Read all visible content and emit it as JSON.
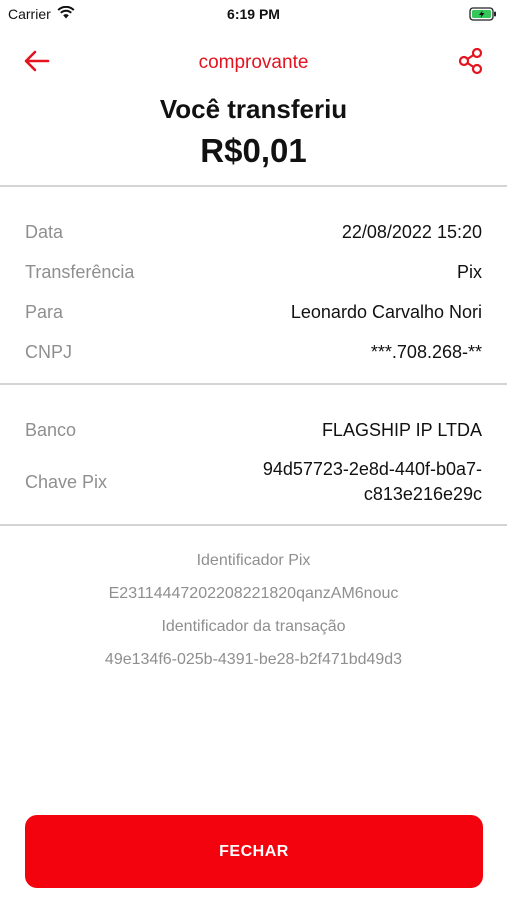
{
  "status_bar": {
    "carrier": "Carrier",
    "time": "6:19 PM"
  },
  "header": {
    "title": "comprovante",
    "accent_color": "#e3131f"
  },
  "hero": {
    "label": "Você transferiu",
    "amount": "R$0,01"
  },
  "details": [
    {
      "label": "Data",
      "value": "22/08/2022 15:20"
    },
    {
      "label": "Transferência",
      "value": "Pix"
    },
    {
      "label": "Para",
      "value": "Leonardo Carvalho Nori"
    },
    {
      "label": "CNPJ",
      "value": "***.708.268-**"
    }
  ],
  "bank": {
    "bank_label": "Banco",
    "bank_value": "FLAGSHIP IP LTDA",
    "key_label": "Chave Pix",
    "key_value_line1": "94d57723-2e8d-440f-b0a7-",
    "key_value_line2": "c813e216e29c"
  },
  "identifiers": {
    "pix_id_label": "Identificador Pix",
    "pix_id_value": "E23114447202208221820qanzAM6nouc",
    "transaction_id_label": "Identificador da transação",
    "transaction_id_value": "49e134f6-025b-4391-be28-b2f471bd49d3"
  },
  "footer": {
    "close_label": "FECHAR",
    "button_color": "#f3030d"
  }
}
